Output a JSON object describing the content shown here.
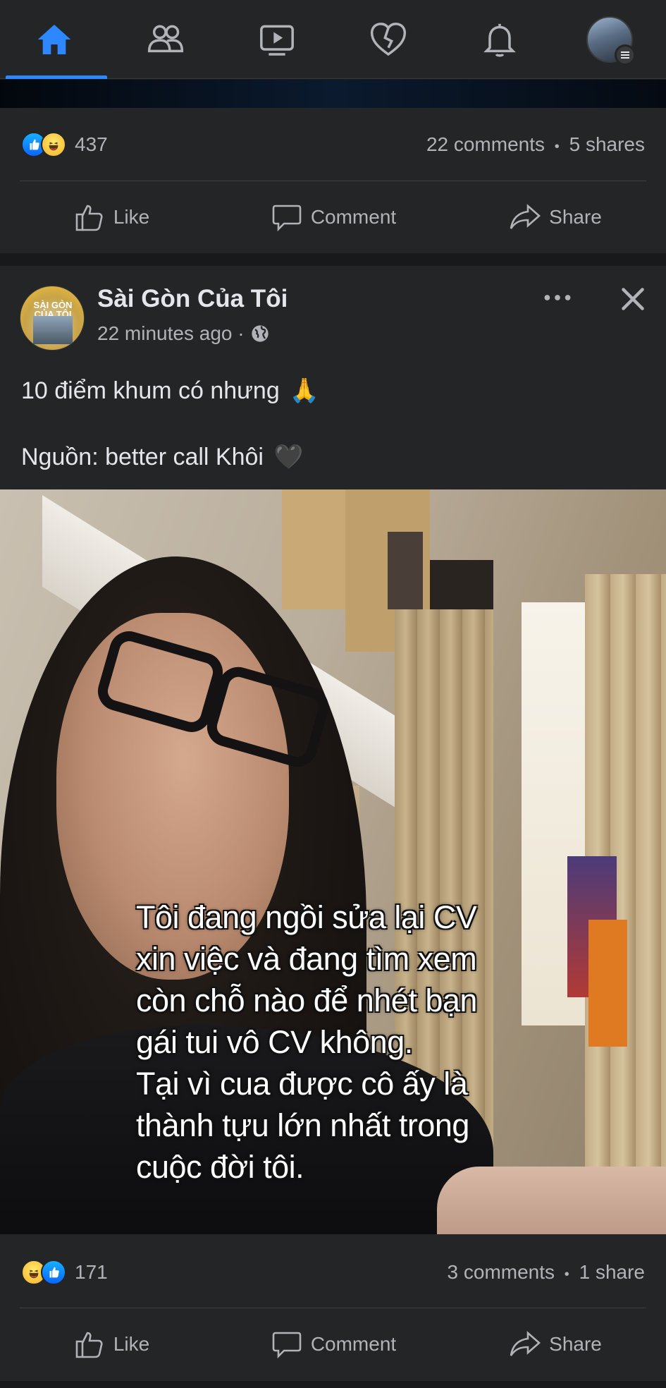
{
  "nav": {
    "tabs": [
      {
        "name": "home",
        "icon": "home-icon",
        "active": true
      },
      {
        "name": "friends",
        "icon": "friends-icon",
        "active": false
      },
      {
        "name": "watch",
        "icon": "video-icon",
        "active": false
      },
      {
        "name": "dating",
        "icon": "heart-icon",
        "active": false
      },
      {
        "name": "notifications",
        "icon": "bell-icon",
        "active": false
      },
      {
        "name": "menu",
        "icon": "profile-avatar",
        "active": false
      }
    ],
    "accent": "#2d88ff"
  },
  "post1": {
    "reaction_count": "437",
    "comments": "22 comments",
    "separator": "•",
    "shares": "5 shares"
  },
  "post2": {
    "page_name": "Sài Gòn Của Tôi",
    "avatar_logo_text": "SÀI GÒN CỦA TÔI",
    "time": "22 minutes ago ·",
    "audience_icon": "globe-icon",
    "text_line1": "10 điểm khum có nhưng",
    "emoji1": "🙏",
    "text_line2": "Nguồn: better call Khôi",
    "emoji2": "🖤",
    "video_caption": [
      "Tôi đang ngồi sửa lại CV",
      "xin việc và đang tìm xem",
      "còn chỗ nào để nhét bạn",
      "gái tui vô CV không.",
      "Tại vì cua được cô ấy là",
      "thành tựu lớn nhất trong",
      "cuộc đời tôi."
    ],
    "reaction_count": "171",
    "comments": "3 comments",
    "separator": "•",
    "shares": "1 share"
  },
  "actions": {
    "like": "Like",
    "comment": "Comment",
    "share": "Share"
  },
  "colors": {
    "background": "#18191a",
    "card": "#242526",
    "text_primary": "#e4e6eb",
    "text_secondary": "#b0b3b8",
    "like_blue": "#0866ff",
    "haha_yellow": "#f7b125"
  }
}
